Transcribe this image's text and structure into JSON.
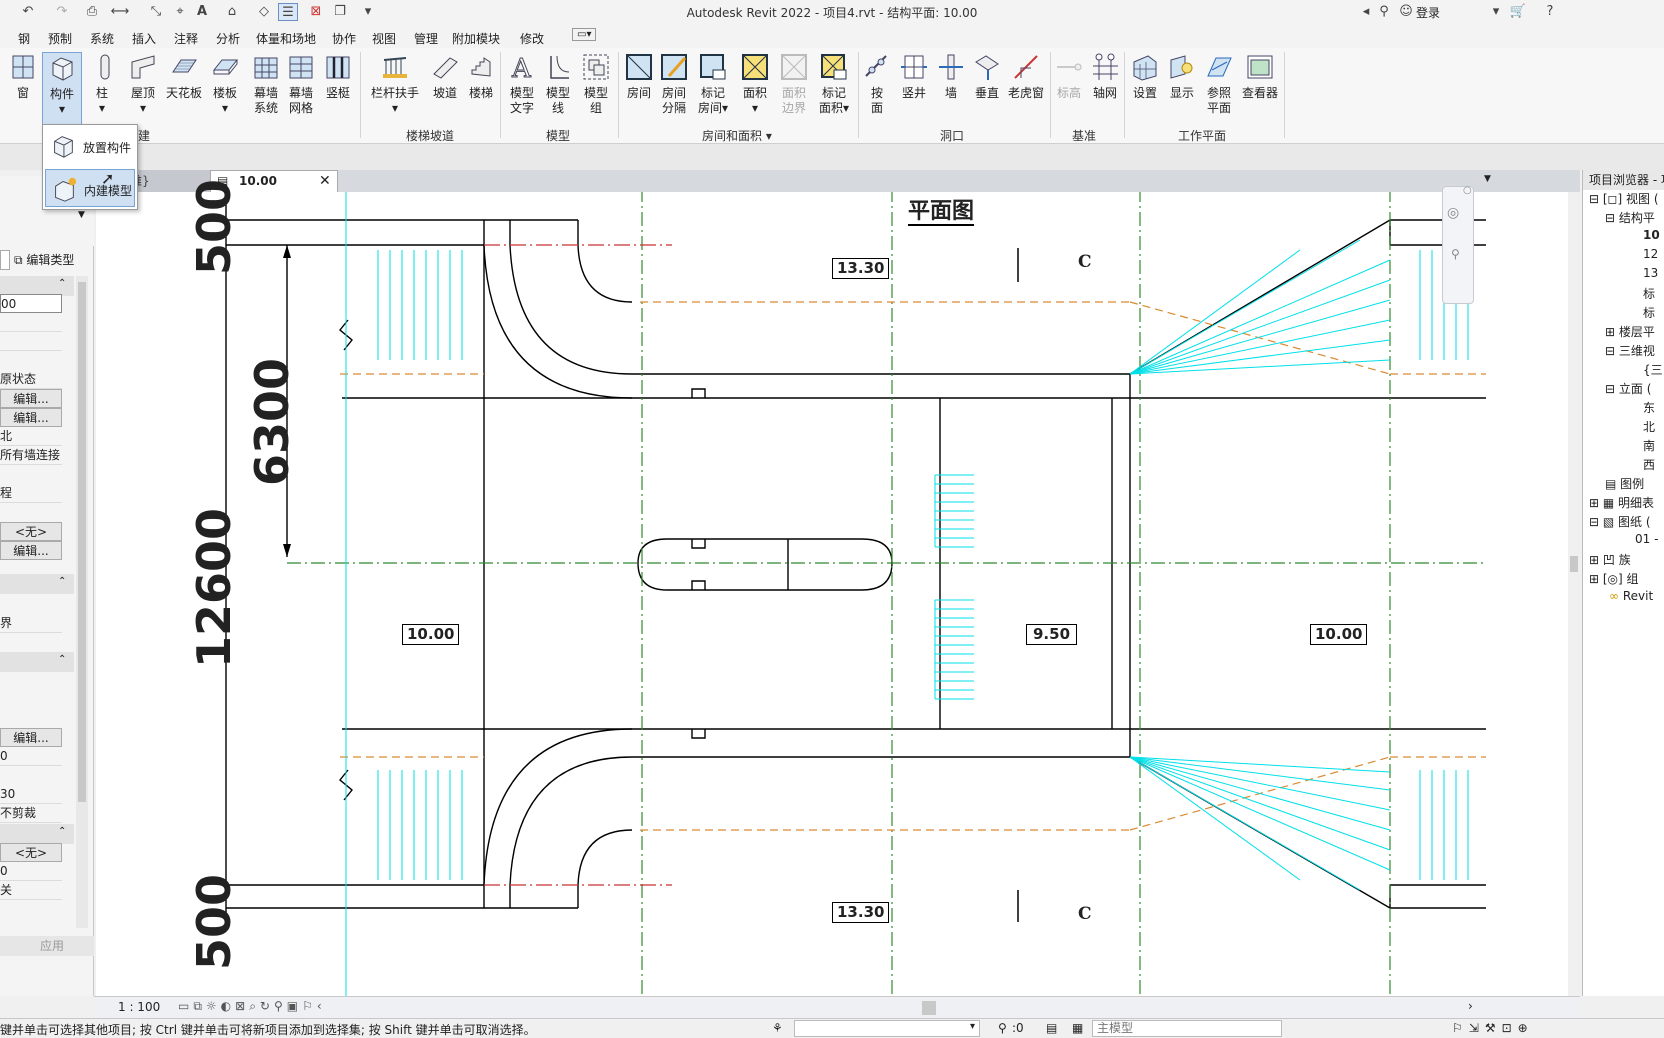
{
  "titlebar": {
    "title": "Autodesk Revit 2022 - 项目4.rvt - 结构平面: 10.00",
    "login": "登录"
  },
  "tabs": [
    "钢",
    "预制",
    "系统",
    "插入",
    "注释",
    "分析",
    "体量和场地",
    "协作",
    "视图",
    "管理",
    "附加模块",
    "修改"
  ],
  "ribbon": {
    "buttons": {
      "window": "窗",
      "component": "构件",
      "column": "柱",
      "roof": "屋顶",
      "ceiling": "天花板",
      "floor": "楼板",
      "curtain_system_1": "幕墙",
      "curtain_system_2": "系统",
      "curtain_grid_1": "幕墙",
      "curtain_grid_2": "网格",
      "mullion": "竖梃",
      "railing": "栏杆扶手",
      "ramp": "坡道",
      "stair": "楼梯",
      "model_text_1": "模型",
      "model_text_2": "文字",
      "model_line_1": "模型",
      "model_line_2": "线",
      "model_group_1": "模型",
      "model_group_2": "组",
      "room": "房间",
      "room_sep_1": "房间",
      "room_sep_2": "分隔",
      "tag_room_1": "标记",
      "tag_room_2": "房间",
      "area": "面积",
      "area_boundary_1": "面积",
      "area_boundary_2": "边界",
      "tag_area_1": "标记",
      "tag_area_2": "面积",
      "by_face_1": "按",
      "by_face_2": "面",
      "shaft": "竖井",
      "wall": "墙",
      "vertical": "垂直",
      "dormer": "老虎窗",
      "level": "标高",
      "grid": "轴网",
      "set": "设置",
      "show": "显示",
      "ref_plane_1": "参照",
      "ref_plane_2": "平面",
      "viewer": "查看器"
    },
    "panels": {
      "build": "构建",
      "circulation": "楼梯坡道",
      "model": "模型",
      "room_area": "房间和面积",
      "opening": "洞口",
      "datum": "基准",
      "work_plane": "工作平面"
    }
  },
  "dropdown": {
    "items": [
      "放置构件",
      "内建模型"
    ]
  },
  "properties": {
    "edit_type": "编辑类型",
    "rows": [
      "00",
      "原状态",
      "编辑...",
      "编辑...",
      "北",
      "所有墙连接",
      "程",
      "<无>",
      "编辑...",
      "界",
      "编辑...",
      "0",
      "30",
      "不剪裁",
      "<无>",
      "0",
      "关"
    ],
    "apply": "应用"
  },
  "view_tabs": {
    "prev": "维}",
    "active": "10.00"
  },
  "drawing": {
    "title": "平面图",
    "dims": {
      "top": "500",
      "mid": "6300",
      "total": "12600",
      "bottom": "500"
    },
    "level_tags": {
      "top_center": "13.30",
      "left": "10.00",
      "center": "9.50",
      "right": "10.00",
      "bottom_center": "13.30"
    },
    "section_top": "C",
    "section_bottom": "C"
  },
  "browser": {
    "title": "项目浏览器 - 项",
    "items": [
      "视图 (",
      "结构平",
      "10",
      "12",
      "13",
      "标",
      "标",
      "楼层平",
      "三维视",
      "{三",
      "立面 (",
      "东",
      "北",
      "南",
      "西",
      "图例",
      "明细表",
      "图纸 (",
      "01 - ",
      "族",
      "组",
      "Revit "
    ]
  },
  "view_control": {
    "scale": "1 : 100"
  },
  "status": {
    "message": "键并单击可选择其他项目; 按 Ctrl 键并单击可将新项目添加到选择集; 按 Shift 键并单击可取消选择。",
    "workset": ":0",
    "model": "主模型"
  },
  "colors": {
    "cyan": "#00e0e8",
    "grid_green": "#2e8b2e",
    "orange_dash": "#d98a30",
    "red_line": "#c83232"
  }
}
